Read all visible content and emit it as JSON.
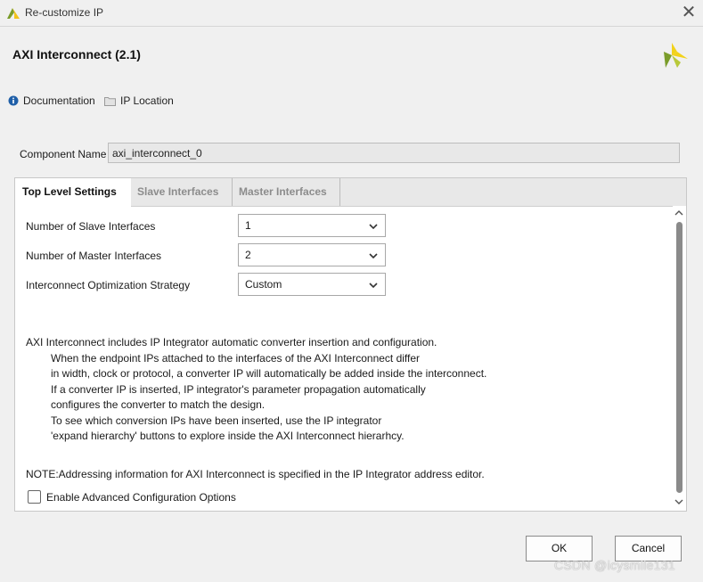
{
  "window": {
    "title": "Re-customize IP",
    "close_icon": "close-icon"
  },
  "header": {
    "title": "AXI Interconnect (2.1)",
    "brand_icon": "xilinx-logo-icon",
    "brand_colors": [
      "#7a9c2a",
      "#f2d21b"
    ]
  },
  "links": [
    {
      "label": "Documentation",
      "icon": "info-icon"
    },
    {
      "label": "IP Location",
      "icon": "folder-icon"
    }
  ],
  "component": {
    "label": "Component Name",
    "value": "axi_interconnect_0"
  },
  "tabs": [
    {
      "label": "Top Level Settings",
      "active": true
    },
    {
      "label": "Slave Interfaces",
      "active": false
    },
    {
      "label": "Master Interfaces",
      "active": false
    }
  ],
  "settings": [
    {
      "label": "Number of Slave Interfaces",
      "value": "1"
    },
    {
      "label": "Number of Master Interfaces",
      "value": "2"
    },
    {
      "label": "Interconnect Optimization Strategy",
      "value": "Custom"
    }
  ],
  "info": {
    "intro": "AXI Interconnect includes IP Integrator automatic converter insertion and configuration.",
    "lines": [
      "When the endpoint IPs attached to the interfaces of the AXI Interconnect differ",
      "in width, clock or protocol, a converter IP will automatically be added inside the interconnect.",
      "If a converter IP is inserted, IP integrator's parameter propagation automatically",
      "configures the converter to match the design.",
      "To see which conversion IPs have been inserted, use the IP integrator",
      "'expand hierarchy' buttons to explore inside the AXI Interconnect hierarhcy."
    ],
    "note": "NOTE:Addressing information for AXI Interconnect is specified in the IP Integrator address editor."
  },
  "advanced": {
    "label": "Enable Advanced Configuration Options",
    "checked": false
  },
  "buttons": {
    "ok": "OK",
    "cancel": "Cancel"
  },
  "watermark": "CSDN @icysmile131"
}
